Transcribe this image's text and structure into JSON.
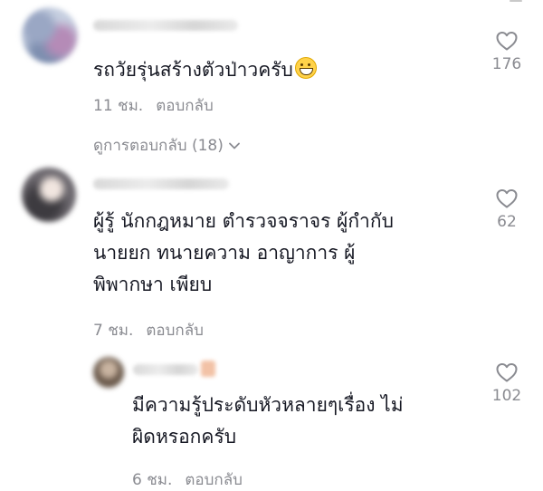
{
  "comments": [
    {
      "text": "รถวัยรุ่นสร้างตัวป่าวครับ",
      "emoji": "grinning-face-emoji",
      "time": "11 ชม.",
      "reply_label": "ตอบกลับ",
      "likes": "176",
      "view_replies": "ดูการตอบกลับ (18)"
    },
    {
      "text_lines": [
        "ผู้รู้ นักกฎหมาย ตำรวจจราจร ผู้กำกับ",
        "นายยก ทนายความ อาญาการ ผู้",
        "พิพากษา เพียบ"
      ],
      "time": "7 ชม.",
      "reply_label": "ตอบกลับ",
      "likes": "62",
      "replies": [
        {
          "text_lines": [
            "มีความรู้ประดับหัวหลายๆเรื่อง ไม่",
            "ผิดหรอกครับ"
          ],
          "time": "6 ชม.",
          "reply_label": "ตอบกลับ",
          "likes": "102"
        }
      ]
    }
  ],
  "icons": {
    "like": "heart-outline-icon",
    "expand": "chevron-down-icon"
  },
  "colors": {
    "text": "#161823",
    "muted": "#8a8b91"
  }
}
